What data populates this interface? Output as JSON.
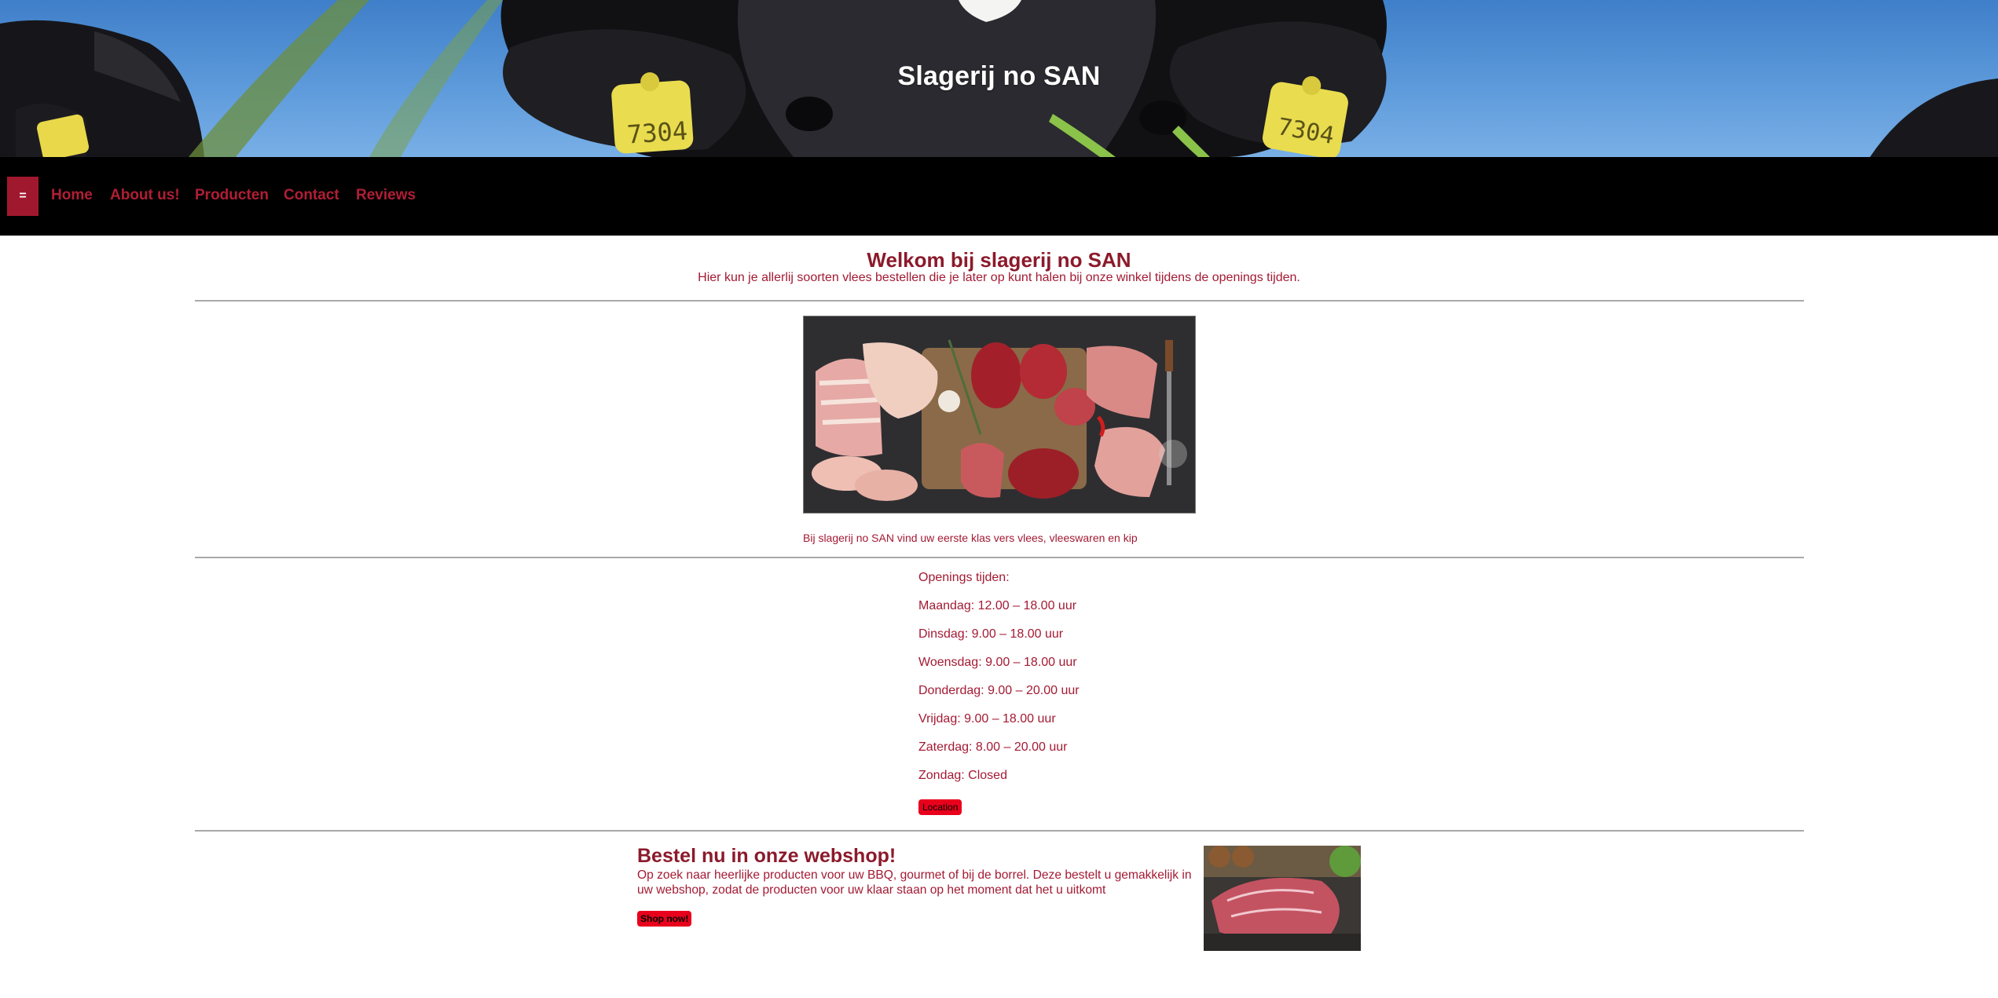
{
  "hero": {
    "title": "Slagerij no SAN",
    "ear_tag_left": "7304",
    "ear_tag_right": "7304"
  },
  "nav": {
    "toggle_label": "=",
    "items": [
      {
        "label": "Home"
      },
      {
        "label": "About us!"
      },
      {
        "label": "Producten"
      },
      {
        "label": "Contact"
      },
      {
        "label": "Reviews"
      }
    ]
  },
  "welcome": {
    "heading": "Welkom bij slagerij no SAN",
    "text": "Hier kun je allerlij soorten vlees bestellen die je later op kunt halen bij onze winkel tijdens de openings tijden."
  },
  "meat_image": {
    "caption": "Bij slagerij no SAN vind uw eerste klas vers vlees, vleeswaren en kip"
  },
  "opening_hours": {
    "heading": "Openings tijden:",
    "days": [
      "Maandag: 12.00 – 18.00 uur",
      "Dinsdag: 9.00 – 18.00 uur",
      "Woensdag: 9.00 – 18.00 uur",
      "Donderdag: 9.00 – 20.00 uur",
      "Vrijdag: 9.00 – 18.00 uur",
      "Zaterdag: 8.00 – 20.00 uur",
      "Zondag: Closed"
    ],
    "location_button": "Location"
  },
  "webshop": {
    "title": "Bestel nu in onze webshop!",
    "text": "Op zoek naar heerlijke producten voor uw BBQ, gourmet of bij de borrel. Deze bestelt u gemakkelijk in uw webshop, zodat de producten voor uw klaar staan op het moment dat het u uitkomt",
    "button": "Shop now!"
  },
  "colors": {
    "accent_red": "#a0182e",
    "text_red": "#a31a33",
    "button_red": "#e8001c",
    "nav_background": "#000000",
    "divider": "#a9a9a9"
  }
}
